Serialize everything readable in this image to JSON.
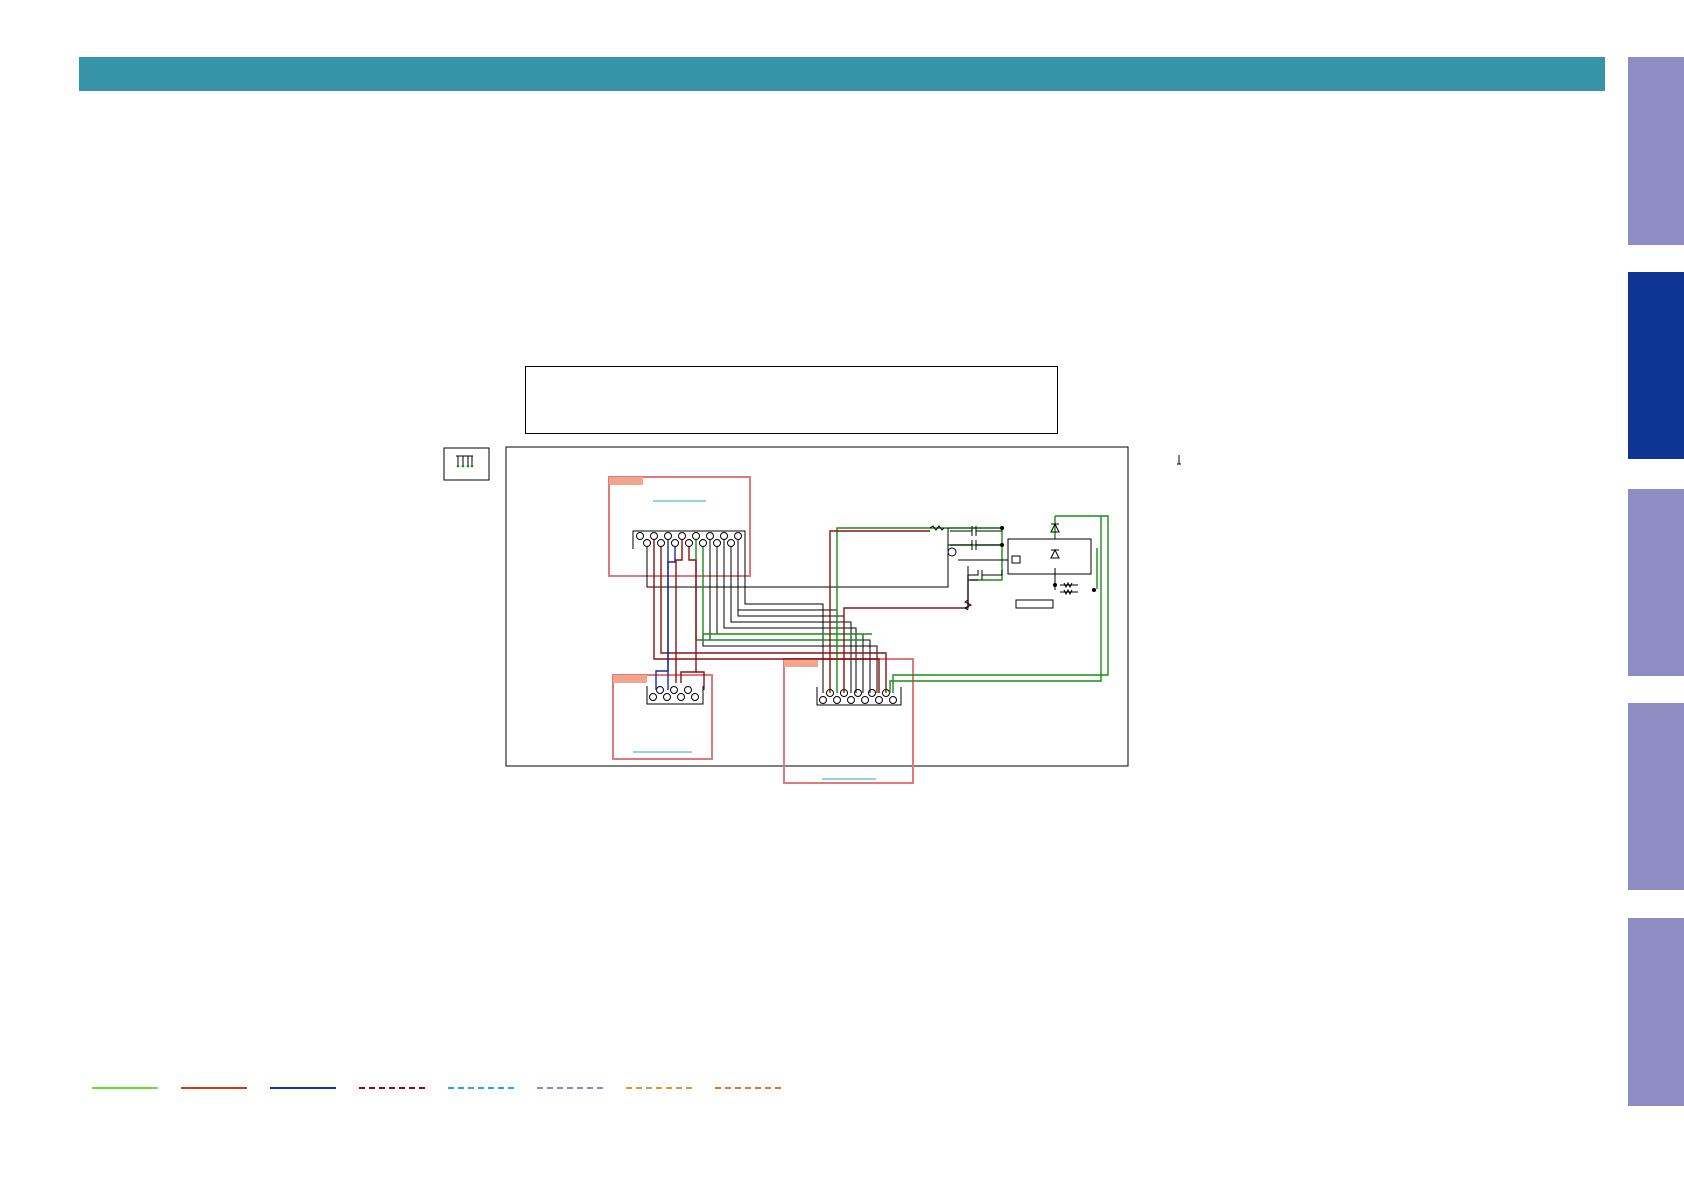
{
  "header": {
    "color": "#3793a8"
  },
  "side_tabs": [
    {
      "color": "#8d8dc4",
      "active": false
    },
    {
      "color": "#0f3594",
      "active": true
    },
    {
      "color": "#8d8dc4",
      "active": false
    },
    {
      "color": "#8d8dc4",
      "active": false
    },
    {
      "color": "#8d8dc4",
      "active": false
    }
  ],
  "wire_colors": {
    "green": "#1a8c1a",
    "red": "#8b1010",
    "blue": "#1a2a9c",
    "black": "#000000",
    "board_outline": "#e07a7a",
    "board_tag": "#f2a48e",
    "board_label_line": "#2aa6c8"
  },
  "legend": [
    {
      "color": "#66dd33",
      "style": "solid"
    },
    {
      "color": "#dd3311",
      "style": "solid"
    },
    {
      "color": "#1133bb",
      "style": "solid"
    },
    {
      "color": "#990011",
      "style": "dashed"
    },
    {
      "color": "#22aadd",
      "style": "dashed"
    },
    {
      "color": "#8888cc",
      "style": "dashed"
    },
    {
      "color": "#dd9922",
      "style": "dashed"
    },
    {
      "color": "#ee7722",
      "style": "dashed"
    }
  ]
}
